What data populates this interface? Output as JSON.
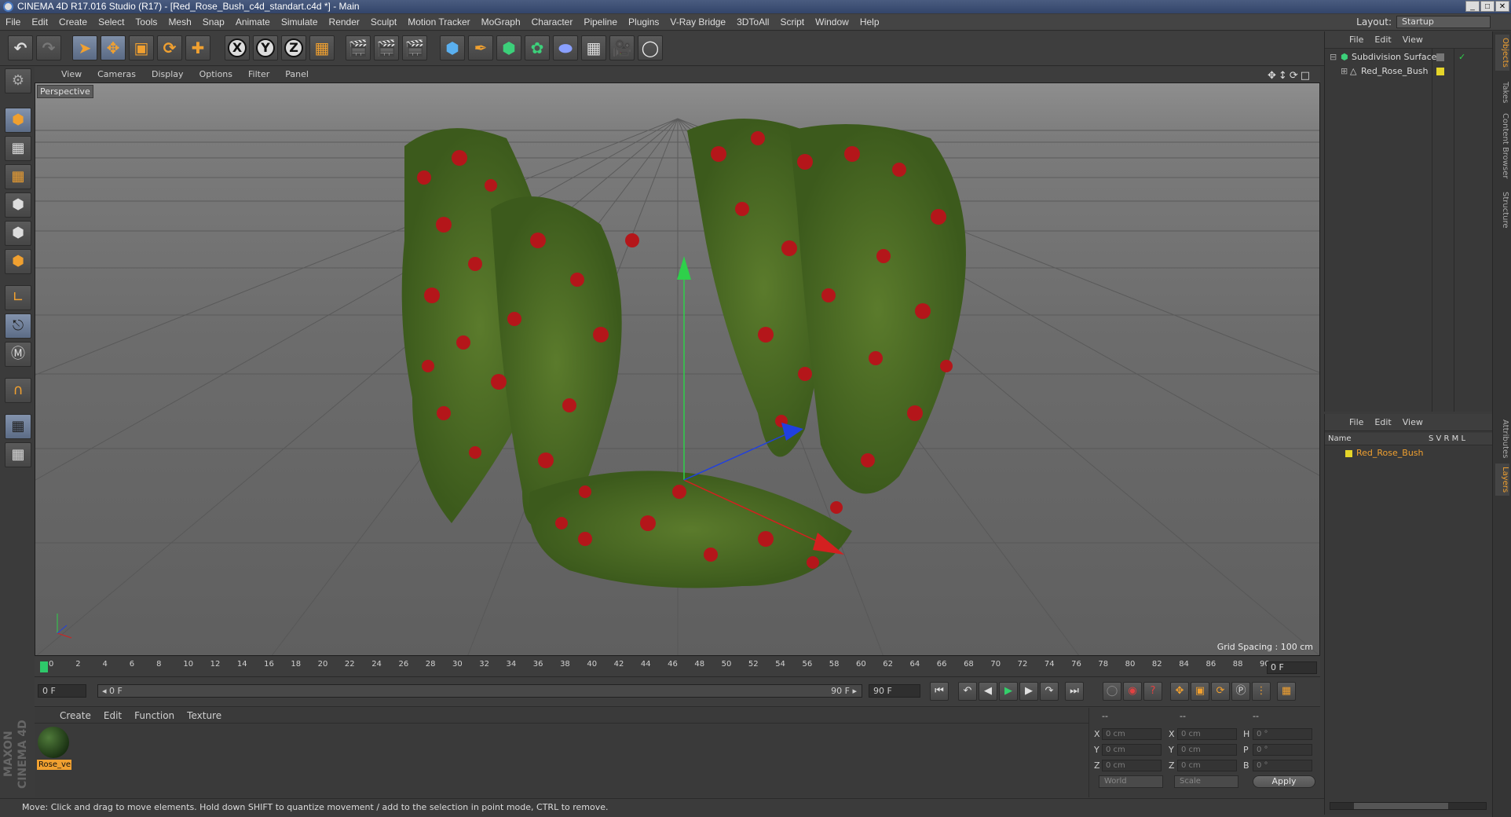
{
  "window": {
    "title": "CINEMA 4D R17.016 Studio (R17) - [Red_Rose_Bush_c4d_standart.c4d *] - Main",
    "min": "_",
    "max": "□",
    "close": "✕"
  },
  "menubar": {
    "items": [
      "File",
      "Edit",
      "Create",
      "Select",
      "Tools",
      "Mesh",
      "Snap",
      "Animate",
      "Simulate",
      "Render",
      "Sculpt",
      "Motion Tracker",
      "MoGraph",
      "Character",
      "Pipeline",
      "Plugins",
      "V-Ray Bridge",
      "3DToAll",
      "Script",
      "Window",
      "Help"
    ],
    "layout_label": "Layout:",
    "layout_value": "Startup"
  },
  "toolbar": {
    "undo": "↶",
    "redo": "↷",
    "axis_x": "X",
    "axis_y": "Y",
    "axis_z": "Z"
  },
  "viewport": {
    "menu": [
      "View",
      "Cameras",
      "Display",
      "Options",
      "Filter",
      "Panel"
    ],
    "nav_icons": "✥↕⟳□",
    "camera_label": "Perspective",
    "grid_spacing": "Grid Spacing : 100 cm"
  },
  "timeline": {
    "ticks": [
      "0",
      "2",
      "4",
      "6",
      "8",
      "10",
      "12",
      "14",
      "16",
      "18",
      "20",
      "22",
      "24",
      "26",
      "28",
      "30",
      "32",
      "34",
      "36",
      "38",
      "40",
      "42",
      "44",
      "46",
      "48",
      "50",
      "52",
      "54",
      "56",
      "58",
      "60",
      "62",
      "64",
      "66",
      "68",
      "70",
      "72",
      "74",
      "76",
      "78",
      "80",
      "82",
      "84",
      "86",
      "88",
      "90"
    ],
    "current_frame": "0 F"
  },
  "playbar": {
    "start_field": "0 F",
    "range_start": "◂ 0 F",
    "range_end": "90 F ▸",
    "end_field": "90 F"
  },
  "material_panel": {
    "menu": [
      "Create",
      "Edit",
      "Function",
      "Texture"
    ],
    "material_name": "Rose_ve"
  },
  "coordinates": {
    "header_pos": "--",
    "header_size": "--",
    "header_rot": "--",
    "labels": {
      "x": "X",
      "y": "Y",
      "z": "Z",
      "sx": "X",
      "sy": "Y",
      "sz": "Z",
      "h": "H",
      "p": "P",
      "b": "B"
    },
    "x": "0 cm",
    "y": "0 cm",
    "z": "0 cm",
    "sx": "0 cm",
    "sy": "0 cm",
    "sz": "0 cm",
    "h": "0 °",
    "p": "0 °",
    "b": "0 °",
    "space": "World",
    "mode": "Scale",
    "apply": "Apply"
  },
  "status": {
    "text": "Move: Click and drag to move elements. Hold down SHIFT to quantize movement / add to the selection in point mode, CTRL to remove."
  },
  "branding": {
    "logo": "MAXON CINEMA 4D"
  },
  "objects_panel": {
    "menu": [
      "File",
      "Edit",
      "View"
    ],
    "items": [
      {
        "name": "Subdivision Surface",
        "check": "✓"
      },
      {
        "name": "Red_Rose_Bush"
      }
    ]
  },
  "layers_panel": {
    "menu": [
      "File",
      "Edit",
      "View"
    ],
    "header_name": "Name",
    "header_cols": "S  V  R  M  L",
    "layer_name": "Red_Rose_Bush"
  },
  "right_tabs": [
    "Objects",
    "Takes",
    "Content Browser",
    "Structure",
    "Attributes",
    "Layers"
  ],
  "colors": {
    "accent": "#f0a030",
    "play_green": "#33d06b",
    "selection_blue": "#7f8fa8"
  }
}
